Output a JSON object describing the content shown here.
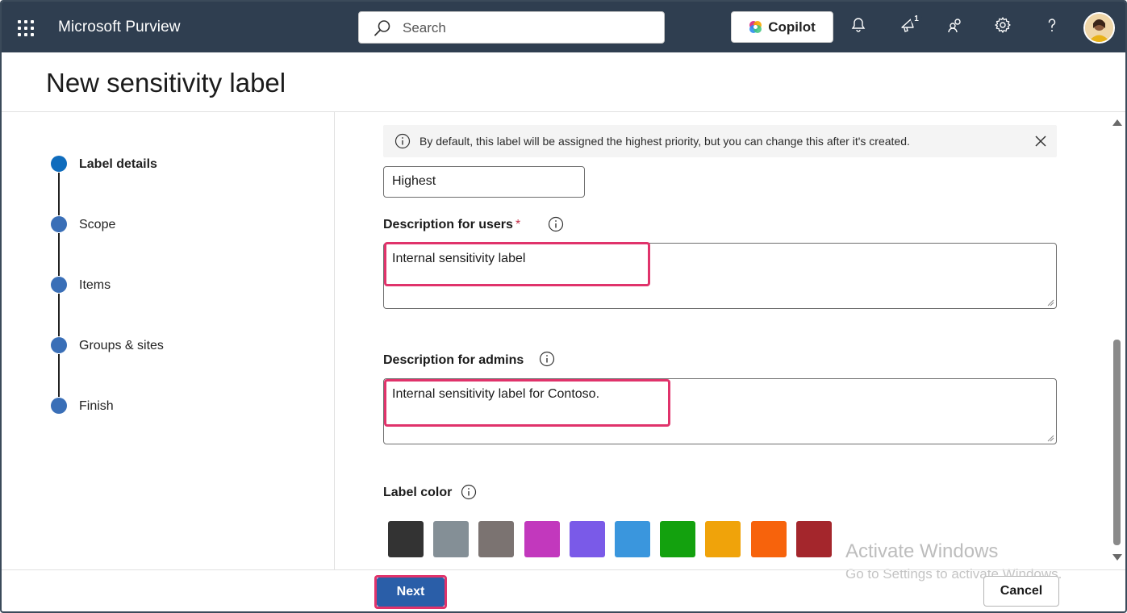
{
  "topbar": {
    "app_title": "Microsoft Purview",
    "search_placeholder": "Search",
    "copilot_label": "Copilot",
    "notification_badge": "1",
    "background": "#2f3e50"
  },
  "page": {
    "title": "New sensitivity label"
  },
  "steps": [
    {
      "label": "Label details",
      "active": true
    },
    {
      "label": "Scope",
      "active": false
    },
    {
      "label": "Items",
      "active": false
    },
    {
      "label": "Groups & sites",
      "active": false
    },
    {
      "label": "Finish",
      "active": false
    }
  ],
  "form": {
    "info_message": "By default, this label will be assigned the highest priority, but you can change this after it's created.",
    "priority_value": "Highest",
    "desc_users_label": "Description for users",
    "desc_users_required": "*",
    "desc_users_value": "Internal sensitivity label",
    "desc_admins_label": "Description for admins",
    "desc_admins_value": "Internal sensitivity label for Contoso.",
    "label_color_label": "Label color",
    "colors": [
      "#333333",
      "#848f96",
      "#7b7371",
      "#c238bd",
      "#7a5ae8",
      "#3a96dd",
      "#13a10e",
      "#f0a30a",
      "#f7630c",
      "#a4262c"
    ]
  },
  "footer": {
    "next_label": "Next",
    "cancel_label": "Cancel"
  },
  "watermark": {
    "line1": "Activate Windows",
    "line2": "Go to Settings to activate Windows."
  },
  "highlight_color": "#e0336b"
}
